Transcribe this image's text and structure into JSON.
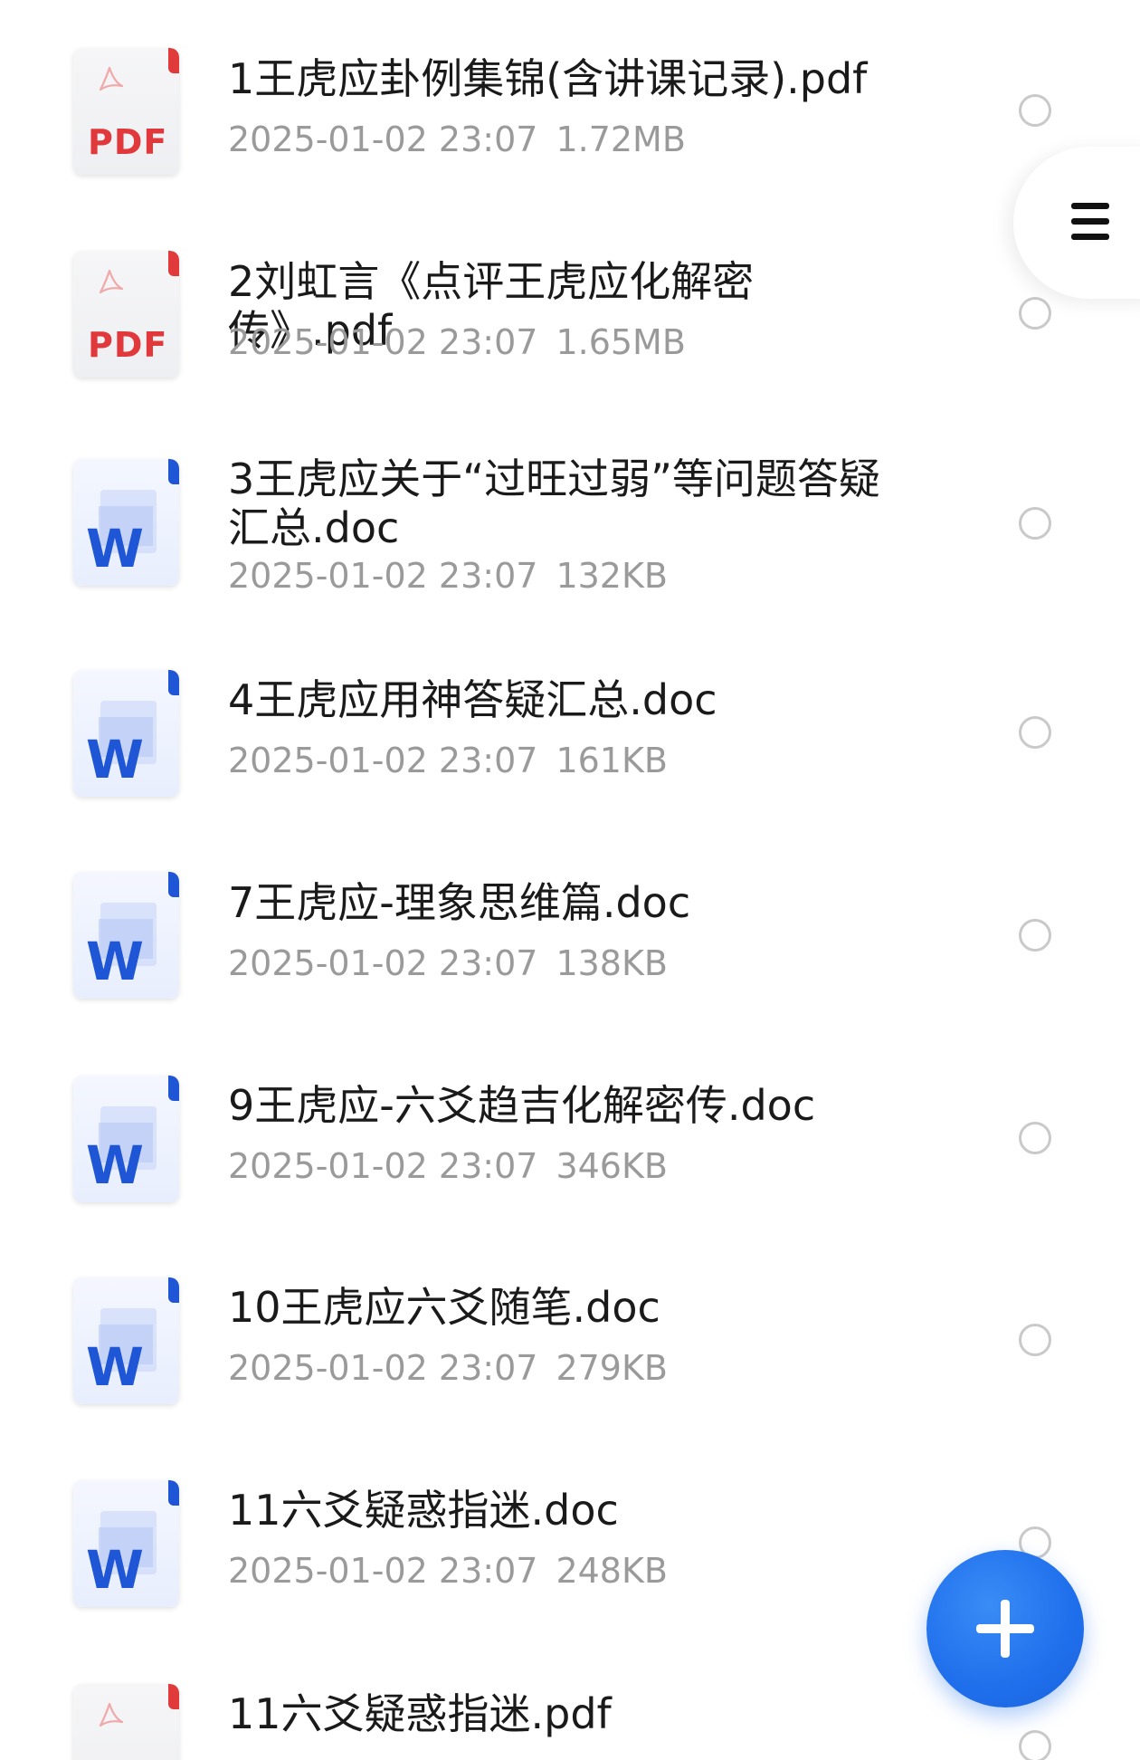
{
  "files": [
    {
      "type": "pdf",
      "name": "1王虎应卦例集锦(含讲课记录).pdf",
      "date": "2025-01-02 23:07",
      "size": "1.72MB"
    },
    {
      "type": "pdf",
      "name": "2刘虹言《点评王虎应化解密传》.pdf",
      "date": "2025-01-02 23:07",
      "size": "1.65MB"
    },
    {
      "type": "doc",
      "name": "3王虎应关于“过旺过弱”等问题答疑\n汇总.doc",
      "date": "2025-01-02 23:07",
      "size": "132KB"
    },
    {
      "type": "doc",
      "name": "4王虎应用神答疑汇总.doc",
      "date": "2025-01-02 23:07",
      "size": "161KB"
    },
    {
      "type": "doc",
      "name": "7王虎应-理象思维篇.doc",
      "date": "2025-01-02 23:07",
      "size": "138KB"
    },
    {
      "type": "doc",
      "name": "9王虎应-六爻趋吉化解密传.doc",
      "date": "2025-01-02 23:07",
      "size": "346KB"
    },
    {
      "type": "doc",
      "name": "10王虎应六爻随笔.doc",
      "date": "2025-01-02 23:07",
      "size": "279KB"
    },
    {
      "type": "doc",
      "name": "11六爻疑惑指迷.doc",
      "date": "2025-01-02 23:07",
      "size": "248KB"
    },
    {
      "type": "pdf",
      "name": "11六爻疑惑指迷.pdf",
      "date": "",
      "size": ""
    }
  ],
  "icons": {
    "pdf_badge": "PDF",
    "doc_badge": "W",
    "menu": "menu-icon",
    "fab": "plus-icon"
  },
  "colors": {
    "pdf_red": "#e0383b",
    "doc_blue": "#1f56d6",
    "fab_blue": "#1f6fec",
    "meta_gray": "#9a9a9a"
  }
}
